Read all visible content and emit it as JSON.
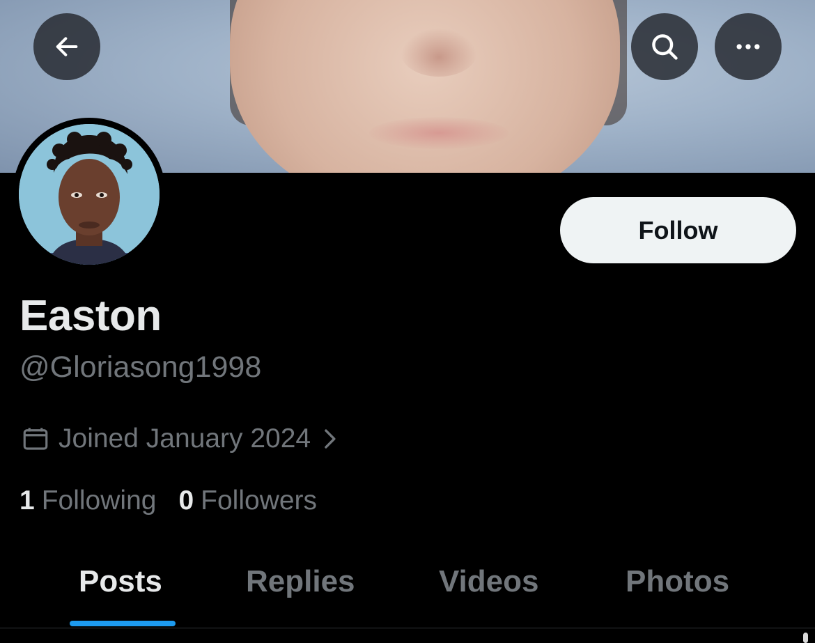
{
  "header": {
    "back_icon": "arrow-left-icon",
    "search_icon": "search-icon",
    "more_icon": "more-horizontal-icon"
  },
  "profile": {
    "display_name": "Easton",
    "handle": "@Gloriasong1998",
    "joined": "Joined January 2024",
    "follow_label": "Follow"
  },
  "stats": {
    "following_count": "1",
    "following_label": "Following",
    "followers_count": "0",
    "followers_label": "Followers"
  },
  "tabs": [
    {
      "label": "Posts",
      "active": true
    },
    {
      "label": "Replies",
      "active": false
    },
    {
      "label": "Videos",
      "active": false
    },
    {
      "label": "Photos",
      "active": false
    }
  ],
  "colors": {
    "background": "#000000",
    "accent": "#1d9bf0",
    "primary_text": "#e7e9ea",
    "secondary_text": "#71767b",
    "follow_button_bg": "#eff3f4"
  }
}
